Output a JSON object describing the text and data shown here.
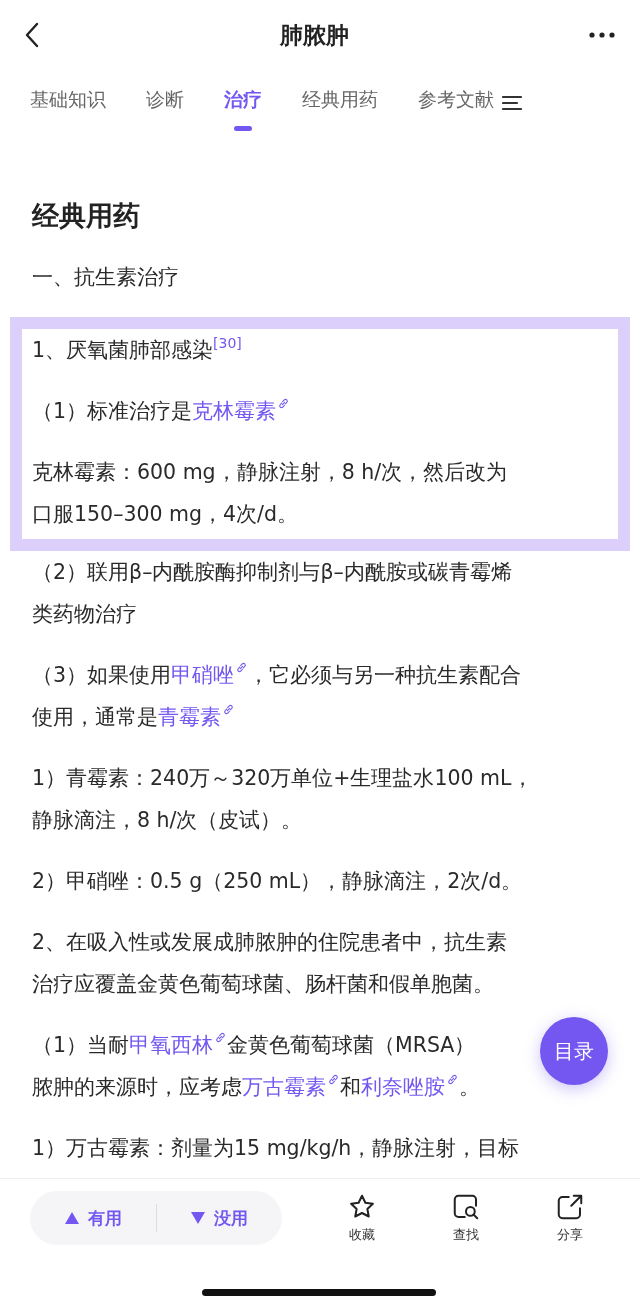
{
  "header": {
    "title": "肺脓肿"
  },
  "tabs": [
    {
      "label": "基础知识",
      "selected": false
    },
    {
      "label": "诊断",
      "selected": false
    },
    {
      "label": "治疗",
      "selected": true
    },
    {
      "label": "经典用药",
      "selected": false
    },
    {
      "label": "参考文献",
      "selected": false
    }
  ],
  "content": [
    {
      "kind": "heading",
      "text": "经典用药"
    },
    {
      "kind": "para",
      "lines": [
        [
          {
            "kind": "text",
            "text": "一、抗生素治疗"
          }
        ]
      ]
    },
    {
      "kind": "highlight",
      "paragraphs": [
        {
          "kind": "para",
          "lines": [
            [
              {
                "kind": "text",
                "text": "1、厌氧菌肺部感染"
              },
              {
                "kind": "ref",
                "text": "[30]"
              }
            ]
          ]
        },
        {
          "kind": "para",
          "lines": [
            [
              {
                "kind": "text",
                "text": "（1）标准治疗是"
              },
              {
                "kind": "link",
                "text": "克林霉素"
              }
            ]
          ]
        },
        {
          "kind": "para",
          "lines": [
            [
              {
                "kind": "text",
                "text": "克林霉素：600 mg，静脉注射，8 h/次，然后改为"
              }
            ],
            [
              {
                "kind": "text",
                "text": "口服150–300 mg，4次/d。"
              }
            ]
          ]
        }
      ]
    },
    {
      "kind": "para",
      "lines": [
        [
          {
            "kind": "text",
            "text": "（2）联用β–内酰胺酶抑制剂与β–内酰胺或碳青霉烯"
          }
        ],
        [
          {
            "kind": "text",
            "text": "类药物治疗"
          }
        ]
      ]
    },
    {
      "kind": "para",
      "lines": [
        [
          {
            "kind": "text",
            "text": "（3）如果使用"
          },
          {
            "kind": "link",
            "text": "甲硝唑"
          },
          {
            "kind": "text",
            "text": "，它必须与另一种抗生素配合"
          }
        ],
        [
          {
            "kind": "text",
            "text": "使用，通常是"
          },
          {
            "kind": "link",
            "text": "青霉素"
          }
        ]
      ]
    },
    {
      "kind": "para",
      "lines": [
        [
          {
            "kind": "text",
            "text": "1）青霉素：240万～320万单位+生理盐水100 mL，"
          }
        ],
        [
          {
            "kind": "text",
            "text": "静脉滴注，8 h/次（皮试）。"
          }
        ]
      ]
    },
    {
      "kind": "para",
      "lines": [
        [
          {
            "kind": "text",
            "text": "2）甲硝唑：0.5 g（250 mL），静脉滴注，2次/d。"
          }
        ]
      ]
    },
    {
      "kind": "para",
      "lines": [
        [
          {
            "kind": "text",
            "text": "2、在吸入性或发展成肺脓肿的住院患者中，抗生素"
          }
        ],
        [
          {
            "kind": "text",
            "text": "治疗应覆盖金黄色葡萄球菌、肠杆菌和假单胞菌。"
          }
        ]
      ]
    },
    {
      "kind": "para",
      "lines": [
        [
          {
            "kind": "text",
            "text": "（1）当耐"
          },
          {
            "kind": "link",
            "text": "甲氧西林"
          },
          {
            "kind": "text",
            "text": "金黄色葡萄球菌（MRSA）"
          }
        ],
        [
          {
            "kind": "text",
            "text": "脓肿的来源时，应考虑"
          },
          {
            "kind": "link",
            "text": "万古霉素"
          },
          {
            "kind": "text",
            "text": "和"
          },
          {
            "kind": "link",
            "text": "利奈唑胺"
          },
          {
            "kind": "text",
            "text": "。"
          }
        ]
      ]
    },
    {
      "kind": "para",
      "lines": [
        [
          {
            "kind": "text",
            "text": "1）万古霉素：剂量为15 mg/kg/h，静脉注射，目标"
          }
        ]
      ]
    }
  ],
  "fab": {
    "label": "目录"
  },
  "feedback": [
    {
      "kind": "up",
      "label": "有用"
    },
    {
      "kind": "down",
      "label": "没用"
    }
  ],
  "actions": [
    {
      "kind": "star",
      "label": "收藏"
    },
    {
      "kind": "find",
      "label": "查找"
    },
    {
      "kind": "share",
      "label": "分享"
    }
  ]
}
